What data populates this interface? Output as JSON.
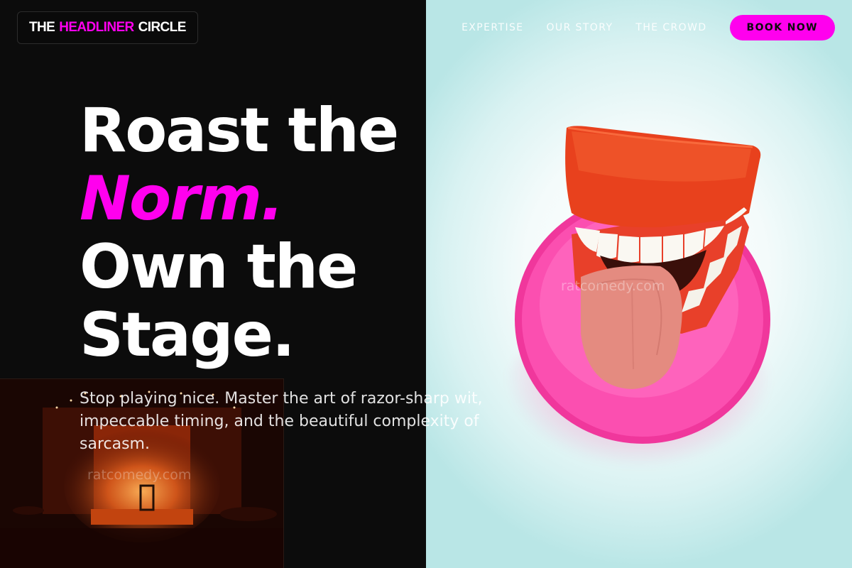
{
  "brand": {
    "part1": "THE",
    "part2": "HEADLINER",
    "part3": "CIRCLE"
  },
  "nav": {
    "items": [
      {
        "label": "EXPERTISE"
      },
      {
        "label": "OUR STORY"
      },
      {
        "label": "THE CROWD"
      }
    ],
    "cta": "BOOK NOW"
  },
  "hero": {
    "line1": "Roast the",
    "line2": "Norm.",
    "line3": "Own the",
    "line4": "Stage.",
    "subtitle": "Stop playing nice. Master the art of razor-sharp wit, impeccable timing, and the beautiful complexity of sarcasm."
  },
  "watermarks": {
    "stage": "ratcomedy.com",
    "photo": "ratcomedy.com"
  },
  "colors": {
    "accent": "#ff00ee",
    "background": "#0c0c0c",
    "text": "#ffffff"
  },
  "images": {
    "hero_photo": "wind-up chattering teeth with tongue on pink sponge",
    "stage_photo": "dim comedy club stage with orange lights"
  }
}
